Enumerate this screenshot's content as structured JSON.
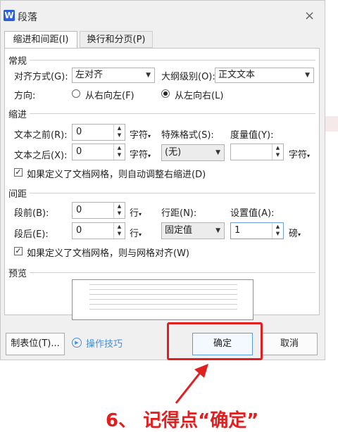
{
  "window": {
    "app_icon": "W",
    "title": "段落",
    "close_label": "×"
  },
  "tabs": [
    {
      "label": "缩进和间距(I)",
      "active": true
    },
    {
      "label": "换行和分页(P)",
      "active": false
    }
  ],
  "general": {
    "heading": "常规",
    "alignment_label": "对齐方式(G):",
    "alignment_value": "左对齐",
    "outline_label": "大纲级别(O):",
    "outline_value": "正文文本",
    "direction_label": "方向:",
    "rtl_label": "从右向左(F)",
    "ltr_label": "从左向右(L)",
    "ltr_selected": true
  },
  "indent": {
    "heading": "缩进",
    "before_label": "文本之前(R):",
    "before_value": "0",
    "before_unit": "字符",
    "after_label": "文本之后(X):",
    "after_value": "0",
    "after_unit": "字符",
    "special_label": "特殊格式(S):",
    "special_value": "(无)",
    "measure_label": "度量值(Y):",
    "measure_value": "",
    "measure_unit": "字符",
    "grid_check_label": "如果定义了文档网格，则自动调整右缩进(D)",
    "grid_checked": true
  },
  "spacing": {
    "heading": "间距",
    "before_label": "段前(B):",
    "before_value": "0",
    "before_unit": "行",
    "after_label": "段后(E):",
    "after_value": "0",
    "after_unit": "行",
    "line_label": "行距(N):",
    "line_value": "固定值",
    "setting_label": "设置值(A):",
    "setting_value": "1",
    "setting_unit": "磅",
    "grid_check_label": "如果定义了文档网格，则与网格对齐(W)",
    "grid_checked": true
  },
  "preview": {
    "heading": "预览"
  },
  "footer": {
    "tabs_button": "制表位(T)...",
    "tips_label": "操作技巧",
    "ok_button": "确定",
    "cancel_button": "取消"
  },
  "annotation": {
    "text": "6、 记得点“确定”"
  },
  "colors": {
    "accent": "#4a8dd8",
    "highlight": "#e02020",
    "dialog_bg": "#f0f0f0"
  },
  "icons": [
    "word-app-icon",
    "close-icon",
    "chevron-down-icon",
    "spin-up-icon",
    "spin-down-icon",
    "check-icon",
    "play-circle-icon",
    "arrow-icon"
  ]
}
